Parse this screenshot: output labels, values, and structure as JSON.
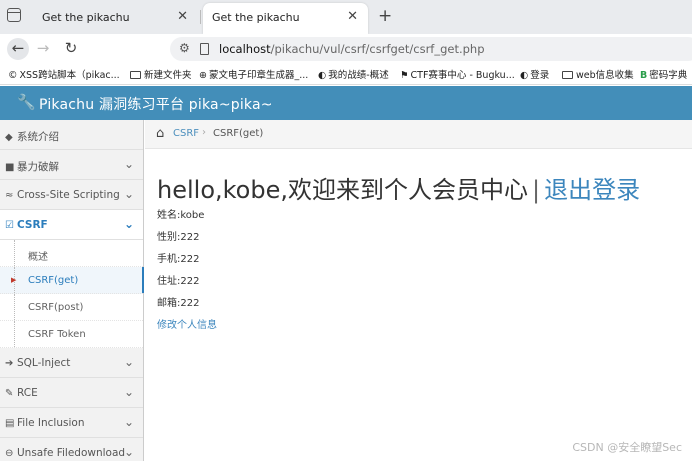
{
  "browser": {
    "tabs": [
      {
        "title": "Get the pikachu",
        "close": "✕"
      },
      {
        "title": "Get the pikachu",
        "close": "✕"
      }
    ],
    "new_tab": "+",
    "url_host": "localhost",
    "url_path": "/pikachu/vul/csrf/csrfget/csrf_get.php",
    "bookmarks": [
      {
        "icon": "©",
        "label": "XSS跨站脚本（pikac..."
      },
      {
        "label": "新建文件夹"
      },
      {
        "icon": "⊕",
        "label": "蒙文电子印章生成器_..."
      },
      {
        "icon": "◐",
        "label": "我的战绩-概述"
      },
      {
        "icon": "⚑",
        "label": "CTF赛事中心 - Bugku..."
      },
      {
        "icon": "◐",
        "label": "登录"
      },
      {
        "label": "web信息收集"
      },
      {
        "icon": "B",
        "label": "密码字典"
      }
    ]
  },
  "site": {
    "title": "Pikachu 漏洞练习平台 pika~pika~"
  },
  "sidebar": {
    "items": [
      {
        "icon": "◆",
        "label": "系统介绍"
      },
      {
        "icon": "■",
        "label": "暴力破解"
      },
      {
        "icon": "≈",
        "label": "Cross-Site Scripting"
      },
      {
        "icon": "☑",
        "label": "CSRF"
      },
      {
        "icon": "➔",
        "label": "SQL-Inject"
      },
      {
        "icon": "✎",
        "label": "RCE"
      },
      {
        "icon": "▤",
        "label": "File Inclusion"
      },
      {
        "icon": "⊖",
        "label": "Unsafe Filedownload"
      }
    ],
    "csrf_sub": [
      "概述",
      "CSRF(get)",
      "CSRF(post)",
      "CSRF Token"
    ]
  },
  "breadcrumb": {
    "parent": "CSRF",
    "separator": "›",
    "current": "CSRF(get)"
  },
  "main": {
    "welcome": "hello,kobe,欢迎来到个人会员中心",
    "pipe": "|",
    "logout": "退出登录",
    "info": [
      "姓名:kobe",
      "性别:222",
      "手机:222",
      "住址:222",
      "邮箱:222"
    ],
    "edit_link": "修改个人信息"
  },
  "watermark": "CSDN @安全瞭望Sec",
  "colors": {
    "header_bg": "#438eb9",
    "link": "#3c86bd",
    "active": "#2b7dbc"
  }
}
